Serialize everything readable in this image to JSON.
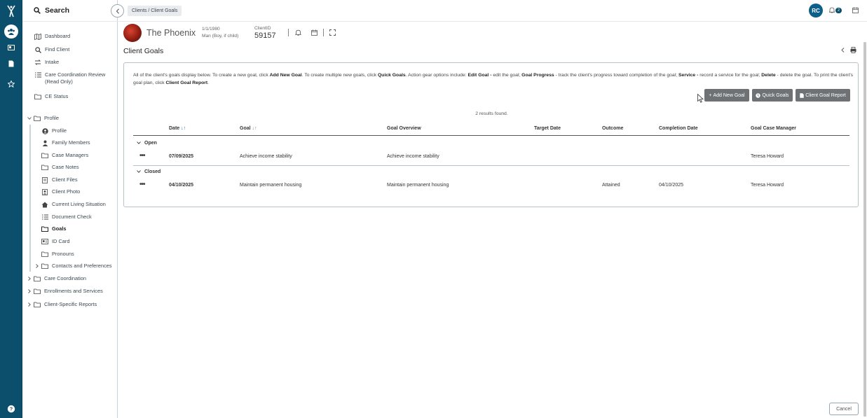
{
  "rail": {
    "icons": [
      "logo-icon",
      "clients-icon",
      "id-card-icon",
      "document-icon",
      "star-icon",
      "help-icon"
    ]
  },
  "sidebar": {
    "search_label": "Search",
    "items": [
      {
        "label": "Dashboard",
        "icon": "map-icon"
      },
      {
        "label": "Find Client",
        "icon": "search-icon"
      },
      {
        "label": "Intake",
        "icon": "intake-icon"
      },
      {
        "label": "Care Coordination Review",
        "label2": "(Read Only)",
        "icon": "list-icon"
      },
      {
        "label": "CE Status",
        "icon": "folder-icon"
      },
      {
        "label": "Profile",
        "icon": "folder-icon"
      },
      {
        "label": "Profile",
        "icon": "user-circle-icon"
      },
      {
        "label": "Family Members",
        "icon": "person-icon"
      },
      {
        "label": "Case Managers",
        "icon": "folder-icon"
      },
      {
        "label": "Case Notes",
        "icon": "folder-icon"
      },
      {
        "label": "Client Files",
        "icon": "file-icon"
      },
      {
        "label": "Client Photo",
        "icon": "photo-icon"
      },
      {
        "label": "Current Living Situation",
        "icon": "home-icon"
      },
      {
        "label": "Document Check",
        "icon": "checklist-icon"
      },
      {
        "label": "Goals",
        "icon": "folder-icon"
      },
      {
        "label": "ID Card",
        "icon": "id-card-icon"
      },
      {
        "label": "Pronouns",
        "icon": "folder-icon"
      },
      {
        "label": "Contacts and Preferences",
        "icon": "folder-icon"
      },
      {
        "label": "Care Coordination",
        "icon": "folder-icon"
      },
      {
        "label": "Enrollments and Services",
        "icon": "folder-icon"
      },
      {
        "label": "Client-Specific Reports",
        "icon": "folder-icon"
      }
    ]
  },
  "topbar": {
    "breadcrumb": "Clients  /  Client Goals",
    "avatar_initials": "RC",
    "notification_count": "2"
  },
  "client": {
    "name": "The Phoenix",
    "dob": "1/1/1980",
    "gender": "Man (Boy, if child)",
    "id_label": "ClientID",
    "id_value": "59157"
  },
  "page": {
    "title": "Client Goals",
    "instructions_parts": {
      "p1": "All of the client's goals display below. To create a new goal, click ",
      "b1": "Add New Goal",
      "p2": ". To create multiple new goals, click ",
      "b2": "Quick Goals",
      "p3": ".  Action gear options include: ",
      "b3": "Edit Goal -",
      "p4": " edit the goal; ",
      "b4": "Goal Progress",
      "p5": " - track the client's progress toward completion of the goal; ",
      "b5": "Service -",
      "p6": " record a service for the goal; ",
      "b6": "Delete",
      "p7": " - delete the goal.  To print the client's goal plan, click ",
      "b7": "Client Goal Report",
      "p8": "."
    },
    "buttons": {
      "add_new_goal": "Add New Goal",
      "quick_goals": "Quick Goals",
      "client_goal_report": "Client Goal Report"
    },
    "results_text": "2 results found.",
    "cancel": "Cancel"
  },
  "table": {
    "columns": [
      "Date",
      "Goal",
      "Goal Overview",
      "Target Date",
      "Outcome",
      "Completion Date",
      "Goal Case Manager"
    ],
    "groups": [
      {
        "name": "Open",
        "rows": [
          {
            "actions": "•••",
            "date": "07/09/2025",
            "goal": "Achieve income stability",
            "overview": "Achieve income stability",
            "target": "",
            "outcome": "",
            "completion": "",
            "manager": "Teresa Howard"
          }
        ]
      },
      {
        "name": "Closed",
        "rows": [
          {
            "actions": "•••",
            "date": "04/10/2025",
            "goal": "Maintain permanent housing",
            "overview": "Maintain permanent housing",
            "target": "",
            "outcome": "Attained",
            "completion": "04/10/2025",
            "manager": "Teresa Howard"
          }
        ]
      }
    ]
  },
  "colors": {
    "rail": "#0b4f6c",
    "button": "#6e7275",
    "avatar": "#0b5f8a"
  }
}
